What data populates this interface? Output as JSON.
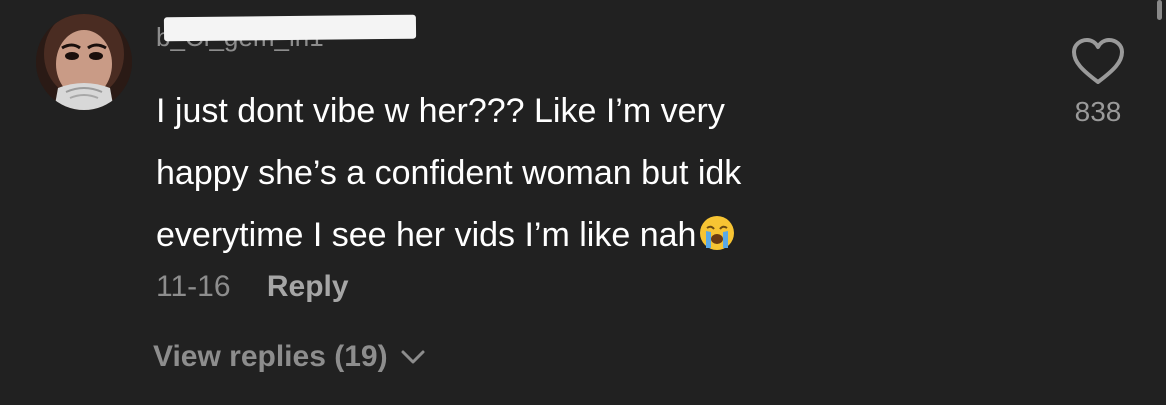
{
  "comment": {
    "username": "b_Cl_gem_in1",
    "lines": [
      "I just dont vibe w her??? Like I’m very",
      "happy she’s a confident woman but idk",
      "everytime I see her vids I’m like nah"
    ],
    "emoji": "loudly-crying-face",
    "date": "11-16",
    "reply_label": "Reply",
    "view_replies_label": "View replies (19)",
    "like_count": "838"
  },
  "icons": {
    "like": "heart-outline-icon",
    "expand": "chevron-down-icon"
  },
  "colors": {
    "background": "#212121",
    "text": "#ffffff",
    "muted": "#8d8d8d",
    "emoji_face": "#f7c433",
    "emoji_tears": "#5aa9e6"
  }
}
